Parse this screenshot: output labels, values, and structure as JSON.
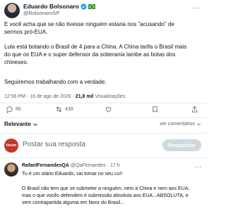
{
  "author": {
    "name": "Eduardo Bolsonaro",
    "handle": "@BolsonaroSP"
  },
  "post": {
    "paragraph1": "E você acha que se não tivesse ninguém estaria nos \"acusando\" de\nsermos pró-EUA.",
    "paragraph2": "Lula está botando o Brasil de 4 para a China. A China tarifa o Brasil mais\ndo que os EUA e o super defensor da soberania lambe as botas dos\nchineses.",
    "paragraph3": "Seguiremos trabalhando com a verdade.",
    "time": "12:56 PM - 16 de ago de 2026 · ",
    "views_count": "21,8 mil",
    "views_label": " Visualizações"
  },
  "actions": {
    "replies": "66",
    "reposts": "439",
    "likes": "",
    "bookmarks": "",
    "share": ""
  },
  "filters": {
    "relevant_label": "Relevante",
    "comments_toggle": "ver comentários"
  },
  "reply_box": {
    "avatar_text": "fórum",
    "placeholder": "Postar sua resposta",
    "button": "Responder"
  },
  "comment": {
    "author": "RafaelFernandesQA",
    "handle": "@QaFernandes · 17 h",
    "line1": "Tu é um otário Eduardo, vai tomar no seu cu!!",
    "line2": "O Brasil não tem que se submeter a ninguém, nem a China e nem aos EUA,\nmas o que vocês defendem é submissão absoluta aos EUA...ABSOLUTA, e\nsem contrapartida alguma em favor do Brasil..."
  },
  "colors": {
    "verified": "#1d9bf0",
    "muted": "#536471",
    "reply_avatar_bg": "#c0392b",
    "reply_button_bg": "#cfd9de"
  },
  "icons": [
    "verified-badge-icon",
    "brazil-flag-icon",
    "more-icon",
    "reply-icon",
    "repost-icon",
    "like-icon",
    "bookmark-icon",
    "share-icon",
    "chevron-down-icon"
  ]
}
